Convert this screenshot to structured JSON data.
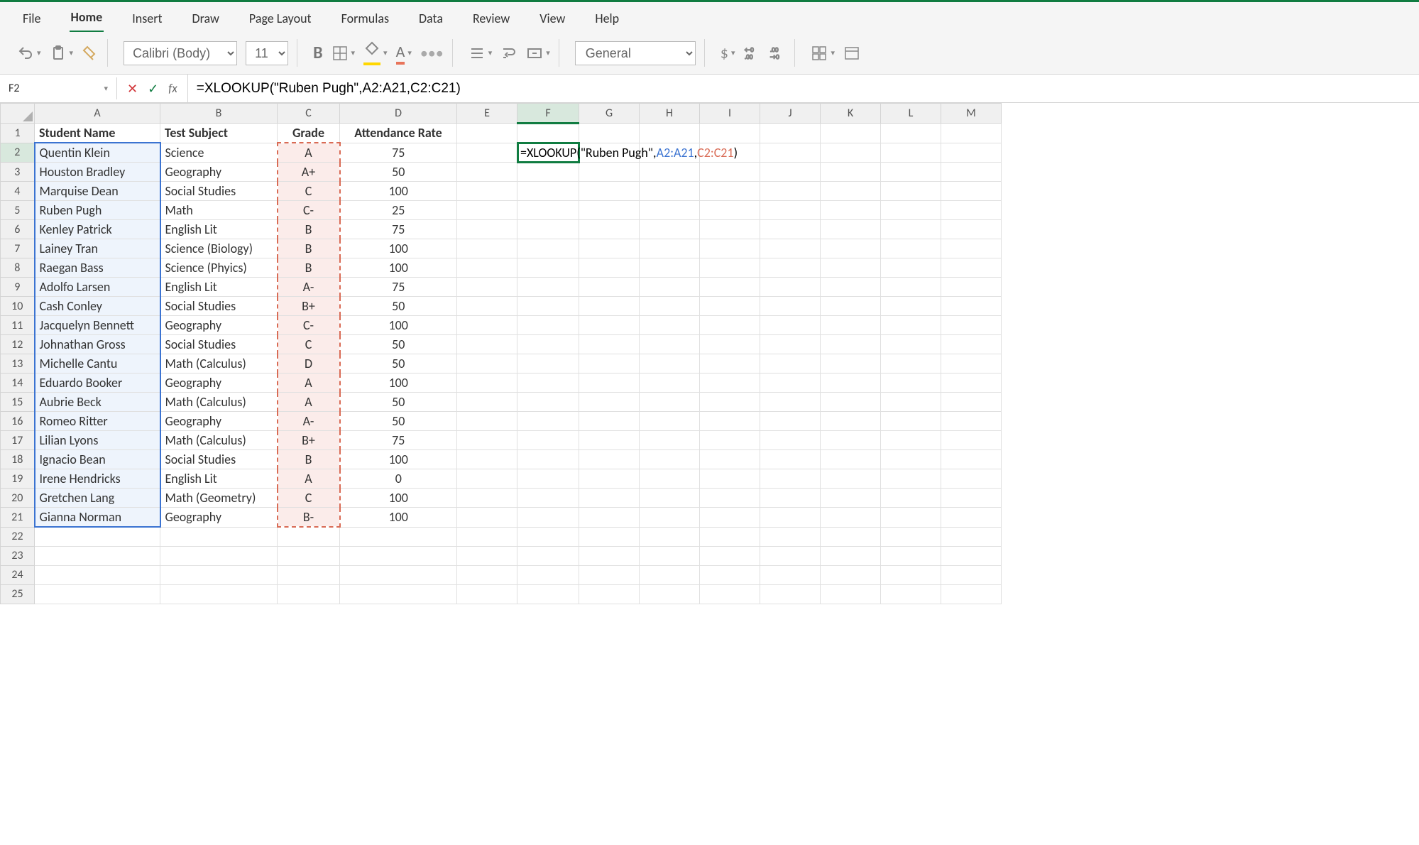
{
  "menu": {
    "items": [
      "File",
      "Home",
      "Insert",
      "Draw",
      "Page Layout",
      "Formulas",
      "Data",
      "Review",
      "View",
      "Help"
    ],
    "active": "Home"
  },
  "ribbon": {
    "font_name": "Calibri (Body)",
    "font_size": "11",
    "number_format": "General"
  },
  "formula_bar": {
    "name_box": "F2",
    "formula": "=XLOOKUP(\"Ruben Pugh\",A2:A21,C2:C21)"
  },
  "columns": [
    "A",
    "B",
    "C",
    "D",
    "E",
    "F",
    "G",
    "H",
    "I",
    "J",
    "K",
    "L",
    "M"
  ],
  "headers": {
    "A": "Student Name",
    "B": "Test Subject",
    "C": "Grade",
    "D": "Attendance Rate"
  },
  "cell_formula": {
    "prefix": "=XLOOKUP(\"Ruben Pugh\",",
    "range1": "A2:A21",
    "comma": ",",
    "range2": "C2:C21",
    "suffix": ")"
  },
  "rows": [
    {
      "r": 1
    },
    {
      "r": 2,
      "A": "Quentin Klein",
      "B": "Science",
      "C": "A",
      "D": "75"
    },
    {
      "r": 3,
      "A": "Houston Bradley",
      "B": "Geography",
      "C": "A+",
      "D": "50"
    },
    {
      "r": 4,
      "A": "Marquise Dean",
      "B": "Social Studies",
      "C": "C",
      "D": "100"
    },
    {
      "r": 5,
      "A": "Ruben Pugh",
      "B": "Math",
      "C": "C-",
      "D": "25"
    },
    {
      "r": 6,
      "A": "Kenley Patrick",
      "B": "English Lit",
      "C": "B",
      "D": "75"
    },
    {
      "r": 7,
      "A": "Lainey Tran",
      "B": "Science (Biology)",
      "C": "B",
      "D": "100"
    },
    {
      "r": 8,
      "A": "Raegan Bass",
      "B": "Science (Phyics)",
      "C": "B",
      "D": "100"
    },
    {
      "r": 9,
      "A": "Adolfo Larsen",
      "B": "English Lit",
      "C": "A-",
      "D": "75"
    },
    {
      "r": 10,
      "A": "Cash Conley",
      "B": "Social Studies",
      "C": "B+",
      "D": "50"
    },
    {
      "r": 11,
      "A": "Jacquelyn Bennett",
      "B": "Geography",
      "C": "C-",
      "D": "100"
    },
    {
      "r": 12,
      "A": "Johnathan Gross",
      "B": "Social Studies",
      "C": "C",
      "D": "50"
    },
    {
      "r": 13,
      "A": "Michelle Cantu",
      "B": "Math (Calculus)",
      "C": "D",
      "D": "50"
    },
    {
      "r": 14,
      "A": "Eduardo Booker",
      "B": "Geography",
      "C": "A",
      "D": "100"
    },
    {
      "r": 15,
      "A": "Aubrie Beck",
      "B": "Math (Calculus)",
      "C": "A",
      "D": "50"
    },
    {
      "r": 16,
      "A": "Romeo Ritter",
      "B": "Geography",
      "C": "A-",
      "D": "50"
    },
    {
      "r": 17,
      "A": "Lilian Lyons",
      "B": "Math (Calculus)",
      "C": "B+",
      "D": "75"
    },
    {
      "r": 18,
      "A": "Ignacio Bean",
      "B": "Social Studies",
      "C": "B",
      "D": "100"
    },
    {
      "r": 19,
      "A": "Irene Hendricks",
      "B": "English Lit",
      "C": "A",
      "D": "0"
    },
    {
      "r": 20,
      "A": "Gretchen Lang",
      "B": "Math (Geometry)",
      "C": "C",
      "D": "100"
    },
    {
      "r": 21,
      "A": "Gianna Norman",
      "B": "Geography",
      "C": "B-",
      "D": "100"
    },
    {
      "r": 22
    },
    {
      "r": 23
    },
    {
      "r": 24
    },
    {
      "r": 25
    }
  ],
  "chart_data": {
    "type": "table",
    "title": "",
    "columns": [
      "Student Name",
      "Test Subject",
      "Grade",
      "Attendance Rate"
    ],
    "data": [
      [
        "Quentin Klein",
        "Science",
        "A",
        75
      ],
      [
        "Houston Bradley",
        "Geography",
        "A+",
        50
      ],
      [
        "Marquise Dean",
        "Social Studies",
        "C",
        100
      ],
      [
        "Ruben Pugh",
        "Math",
        "C-",
        25
      ],
      [
        "Kenley Patrick",
        "English Lit",
        "B",
        75
      ],
      [
        "Lainey Tran",
        "Science (Biology)",
        "B",
        100
      ],
      [
        "Raegan Bass",
        "Science (Phyics)",
        "B",
        100
      ],
      [
        "Adolfo Larsen",
        "English Lit",
        "A-",
        75
      ],
      [
        "Cash Conley",
        "Social Studies",
        "B+",
        50
      ],
      [
        "Jacquelyn Bennett",
        "Geography",
        "C-",
        100
      ],
      [
        "Johnathan Gross",
        "Social Studies",
        "C",
        50
      ],
      [
        "Michelle Cantu",
        "Math (Calculus)",
        "D",
        50
      ],
      [
        "Eduardo Booker",
        "Geography",
        "A",
        100
      ],
      [
        "Aubrie Beck",
        "Math (Calculus)",
        "A",
        50
      ],
      [
        "Romeo Ritter",
        "Geography",
        "A-",
        50
      ],
      [
        "Lilian Lyons",
        "Math (Calculus)",
        "B+",
        75
      ],
      [
        "Ignacio Bean",
        "Social Studies",
        "B",
        100
      ],
      [
        "Irene Hendricks",
        "English Lit",
        "A",
        0
      ],
      [
        "Gretchen Lang",
        "Math (Geometry)",
        "C",
        100
      ],
      [
        "Gianna Norman",
        "Geography",
        "B-",
        100
      ]
    ]
  }
}
